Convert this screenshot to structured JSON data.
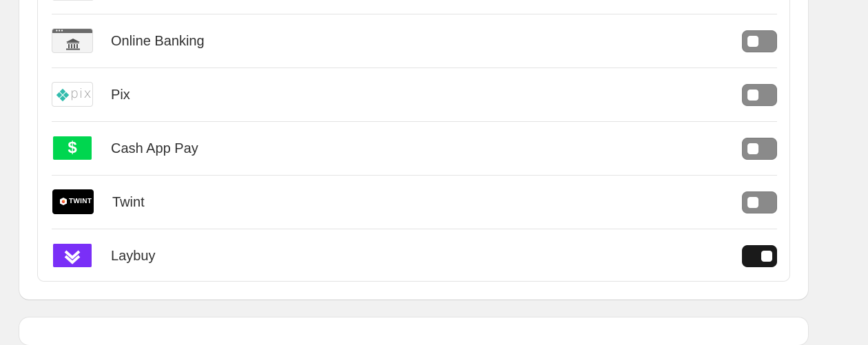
{
  "payment_methods": {
    "items": [
      {
        "name": "Online Banking",
        "logo": "bank-icon",
        "enabled": false
      },
      {
        "name": "Pix",
        "logo": "pix-logo",
        "logo_text": "pix",
        "enabled": false
      },
      {
        "name": "Cash App Pay",
        "logo": "cash-app-logo",
        "logo_text": "$",
        "enabled": false
      },
      {
        "name": "Twint",
        "logo": "twint-logo",
        "logo_text": "TWINT",
        "enabled": false
      },
      {
        "name": "Laybuy",
        "logo": "laybuy-logo",
        "enabled": true
      }
    ]
  },
  "colors": {
    "toggle_on": "#1a1a1a",
    "toggle_off": "#8a8a8a",
    "cash_app_green": "#00d64f",
    "pix_teal": "#32bcad",
    "laybuy_purple": "#7a2ff7"
  }
}
